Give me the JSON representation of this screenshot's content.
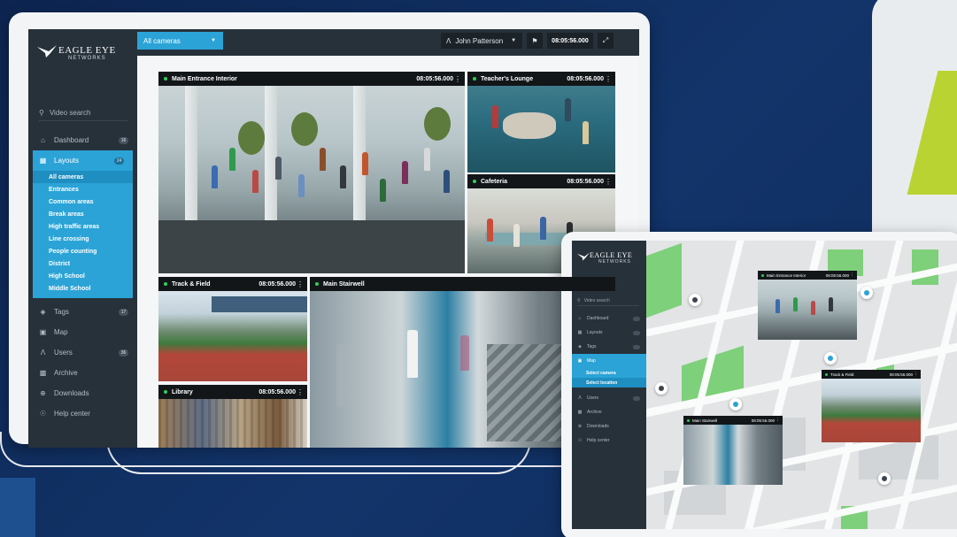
{
  "brand": {
    "name": "EAGLE EYE",
    "sub": "NETWORKS"
  },
  "desktop": {
    "search_label": "Video search",
    "nav": [
      {
        "key": "dashboard",
        "label": "Dashboard",
        "icon": "home-icon",
        "badge": "16"
      },
      {
        "key": "layouts",
        "label": "Layouts",
        "icon": "grid-icon",
        "badge": "24",
        "active": true
      },
      {
        "key": "tags",
        "label": "Tags",
        "icon": "tag-icon",
        "badge": "17"
      },
      {
        "key": "map",
        "label": "Map",
        "icon": "map-icon",
        "badge": ""
      },
      {
        "key": "users",
        "label": "Users",
        "icon": "user-icon",
        "badge": "36"
      },
      {
        "key": "archive",
        "label": "Archive",
        "icon": "archive-icon",
        "badge": ""
      },
      {
        "key": "downloads",
        "label": "Downloads",
        "icon": "download-icon",
        "badge": ""
      },
      {
        "key": "help",
        "label": "Help center",
        "icon": "help-icon",
        "badge": ""
      }
    ],
    "layouts_sub": [
      "All cameras",
      "Entrances",
      "Common areas",
      "Break areas",
      "High traffic areas",
      "Line crossing",
      "People counting",
      "District",
      "High School",
      "Middle School"
    ],
    "topbar": {
      "layout_select": "All cameras",
      "user": "John Patterson",
      "time": "08:05:56.000"
    },
    "cameras": [
      {
        "title": "Main Entrance Interior",
        "time": "08:05:56.000"
      },
      {
        "title": "Teacher's Lounge",
        "time": "08:05:56.000"
      },
      {
        "title": "Cafeteria",
        "time": "08:05:56.000"
      },
      {
        "title": "Track & Field",
        "time": "08:05:56.000"
      },
      {
        "title": "Main Stairwell",
        "time": ""
      },
      {
        "title": "Library",
        "time": "08:05:56.000"
      }
    ]
  },
  "tablet": {
    "search_label": "Video search",
    "nav": [
      {
        "label": "Dashboard",
        "icon": "home-icon"
      },
      {
        "label": "Layouts",
        "icon": "grid-icon"
      },
      {
        "label": "Tags",
        "icon": "tag-icon"
      },
      {
        "label": "Map",
        "icon": "map-icon",
        "active": true
      },
      {
        "label": "Users",
        "icon": "user-icon"
      },
      {
        "label": "Archive",
        "icon": "archive-icon"
      },
      {
        "label": "Downloads",
        "icon": "download-icon"
      },
      {
        "label": "Help center",
        "icon": "help-icon"
      }
    ],
    "map_sub": [
      "Select camera",
      "Select location"
    ],
    "cameras": [
      {
        "title": "Main Entrance Interior",
        "time": "08:05:56.000"
      },
      {
        "title": "Track & Field",
        "time": "08:05:56.000"
      },
      {
        "title": "Main Stairwell",
        "time": "08:05:56.000"
      }
    ]
  },
  "colors": {
    "accent": "#2ba3d6",
    "sidebar": "#27313a",
    "live_dot": "#2fd05b",
    "brand_green": "#b9d432"
  }
}
